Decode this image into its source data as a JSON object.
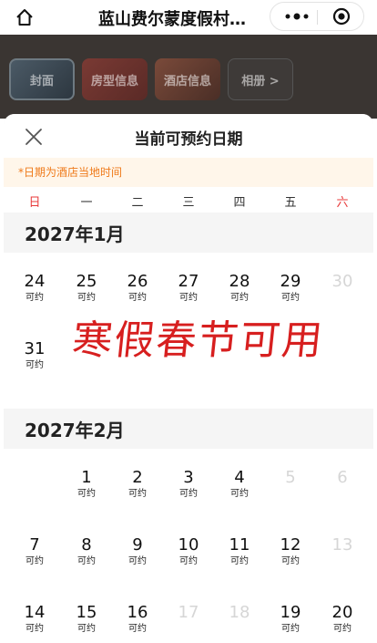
{
  "app": {
    "title": "蓝山费尔蒙度假村…",
    "home_icon": "home-icon",
    "more_icon": "more-dots-icon",
    "target_icon": "target-icon"
  },
  "tabs": [
    {
      "label": "封面"
    },
    {
      "label": "房型信息"
    },
    {
      "label": "酒店信息"
    },
    {
      "label": "相册 >"
    }
  ],
  "sheet": {
    "title": "当前可预约日期",
    "close_icon": "close-icon",
    "notice": "*日期为酒店当地时间",
    "weekdays": [
      "日",
      "一",
      "二",
      "三",
      "四",
      "五",
      "六"
    ],
    "weekend_color": "#e83a3a",
    "notice_color": "#ef7a1a"
  },
  "overlay_text": "寒假春节可用",
  "months": [
    {
      "title": "2027年1月",
      "weeks": [
        [
          {
            "d": "24",
            "s": "可约"
          },
          {
            "d": "25",
            "s": "可约"
          },
          {
            "d": "26",
            "s": "可约"
          },
          {
            "d": "27",
            "s": "可约"
          },
          {
            "d": "28",
            "s": "可约"
          },
          {
            "d": "29",
            "s": "可约"
          },
          {
            "d": "30",
            "s": ""
          }
        ],
        [
          {
            "d": "31",
            "s": "可约"
          },
          null,
          null,
          null,
          null,
          null,
          null
        ]
      ]
    },
    {
      "title": "2027年2月",
      "weeks": [
        [
          null,
          {
            "d": "1",
            "s": "可约"
          },
          {
            "d": "2",
            "s": "可约"
          },
          {
            "d": "3",
            "s": "可约"
          },
          {
            "d": "4",
            "s": "可约"
          },
          {
            "d": "5",
            "s": ""
          },
          {
            "d": "6",
            "s": ""
          }
        ],
        [
          {
            "d": "7",
            "s": "可约"
          },
          {
            "d": "8",
            "s": "可约"
          },
          {
            "d": "9",
            "s": "可约"
          },
          {
            "d": "10",
            "s": "可约"
          },
          {
            "d": "11",
            "s": "可约"
          },
          {
            "d": "12",
            "s": "可约"
          },
          {
            "d": "13",
            "s": ""
          }
        ],
        [
          {
            "d": "14",
            "s": "可约"
          },
          {
            "d": "15",
            "s": "可约"
          },
          {
            "d": "16",
            "s": "可约"
          },
          {
            "d": "17",
            "s": ""
          },
          {
            "d": "18",
            "s": ""
          },
          {
            "d": "19",
            "s": "可约"
          },
          {
            "d": "20",
            "s": "可约"
          }
        ]
      ]
    }
  ]
}
